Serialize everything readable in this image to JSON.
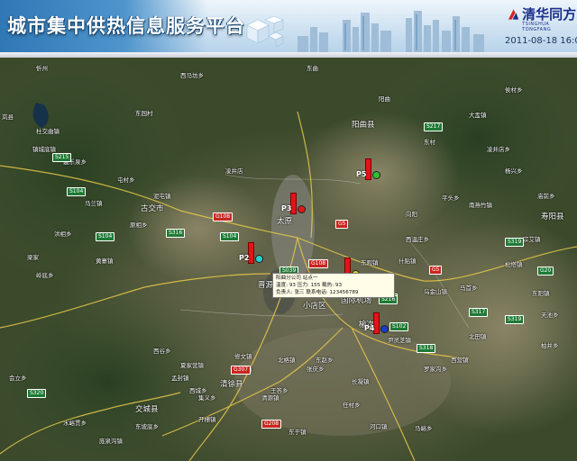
{
  "header": {
    "title": "城市集中供热信息服务平台",
    "logo_text": "清华同方",
    "logo_sub": "TSINGHUA TONGFANG",
    "datetime": "2011-08-18 16:0"
  },
  "popup": {
    "line1": "阳曲分公司  站点一",
    "line2": "温度: 93  压力: 155  载热: 93",
    "line3": "负责人: 张三      联系电话: 123456789"
  },
  "stations": [
    {
      "label": "P5",
      "dot_color": "#2ec02e"
    },
    {
      "label": "P3",
      "dot_color": "#e01818"
    },
    {
      "label": "P2",
      "dot_color": "#2ad0d0"
    },
    {
      "label": "",
      "dot_color": "#e8d820"
    },
    {
      "label": "P4",
      "dot_color": "#1a3ad0"
    }
  ],
  "places": {
    "yangqu": "阳曲县",
    "gujiao": "古交市",
    "taiyuan": "太原",
    "jinyuan": "晋源区",
    "xiaodian": "小店区",
    "qingxu": "清徐县",
    "jiaocheng": "交城县",
    "yuci": "榆次",
    "shouyang": "寿阳县",
    "wucheng": "武宿",
    "guojijichang": "国际机场",
    "xinzhou": "忻州",
    "dongqu": "东曲",
    "lanxian": "岚县"
  },
  "small_places": [
    "杜交曲镇",
    "西马坊乡",
    "东园村",
    "阳曲",
    "大盂镇",
    "侯村乡",
    "凌井店乡",
    "东村",
    "杨兴乡",
    "庙前乡",
    "镇城底镇",
    "马兰镇",
    "原相乡",
    "嘉乐泉乡",
    "屯村乡",
    "梁家",
    "黄寨镇",
    "泥屯镇",
    "凌井店",
    "向阳",
    "西温庄乡",
    "什贴镇",
    "松塔镇",
    "东赵乡",
    "北格镇",
    "张庆乡",
    "修文镇",
    "长凝镇",
    "北田镇",
    "东阳镇",
    "乌金山镇",
    "东观镇",
    "马首乡",
    "平头乡",
    "南燕竹镇",
    "宗艾镇",
    "尹灵芝镇",
    "徐沟镇",
    "集义乡",
    "孟封镇",
    "王答乡",
    "西谷乡",
    "洪相乡",
    "岭底乡",
    "会立乡",
    "水峪贯乡",
    "庞泉沟镇",
    "东坡底乡",
    "夏家营镇",
    "西城乡",
    "开栅镇",
    "任村乡",
    "清源镇",
    "马峪乡",
    "东于镇",
    "罗家沟乡",
    "西营镇",
    "天池乡",
    "柏井乡",
    "河口镇"
  ],
  "roads": [
    "S215",
    "S104",
    "S316",
    "S104",
    "G5",
    "S317",
    "G20",
    "S216",
    "S102",
    "S318",
    "S320",
    "S216",
    "G208",
    "G307",
    "S039",
    "G5",
    "G108",
    "G208",
    "S104",
    "S319",
    "G108",
    "S217",
    "S319"
  ]
}
